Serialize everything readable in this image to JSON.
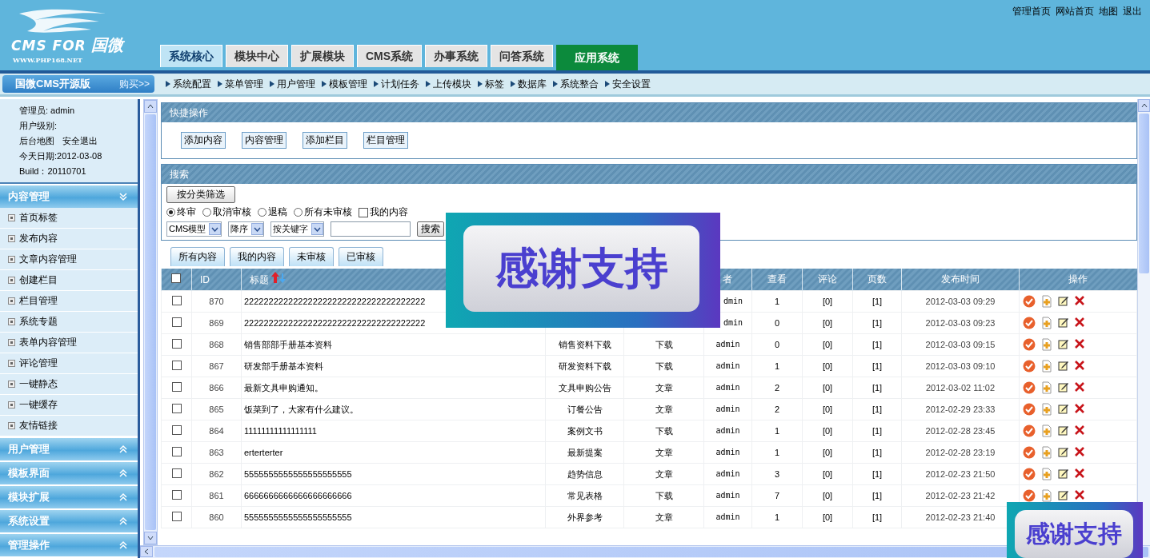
{
  "header": {
    "logo": {
      "text": "CMS FOR",
      "cn": "国微",
      "url": "WWW.PHP168.NET"
    },
    "top_links": [
      "管理首页",
      "网站首页",
      "地图",
      "退出"
    ],
    "tabs": [
      {
        "label": "系统核心",
        "selected": true,
        "kind": "normal"
      },
      {
        "label": "模块中心",
        "selected": false,
        "kind": "normal"
      },
      {
        "label": "扩展模块",
        "selected": false,
        "kind": "normal"
      },
      {
        "label": "CMS系统",
        "selected": false,
        "kind": "normal"
      },
      {
        "label": "办事系统",
        "selected": false,
        "kind": "normal"
      },
      {
        "label": "问答系统",
        "selected": false,
        "kind": "normal"
      },
      {
        "label": "应用系统",
        "selected": false,
        "kind": "app"
      }
    ]
  },
  "subnav": {
    "brand": "国微CMS开源版",
    "buy": "购买>>",
    "links": [
      "系统配置",
      "菜单管理",
      "用户管理",
      "模板管理",
      "计划任务",
      "上传模块",
      "标签",
      "数据库",
      "系统整合",
      "安全设置"
    ]
  },
  "sidebar": {
    "info": [
      "管理员: admin",
      "用户级别:",
      "今天日期:2012-03-08",
      "Build：20110701"
    ],
    "info_links": [
      "后台地图",
      "安全退出"
    ],
    "sections": [
      {
        "title": "内容管理",
        "expanded": true,
        "items": [
          "首页标签",
          "发布内容",
          "文章内容管理",
          "创建栏目",
          "栏目管理",
          "系统专题",
          "表单内容管理",
          "评论管理",
          "一键静态",
          "一键缓存",
          "友情链接"
        ]
      },
      {
        "title": "用户管理",
        "expanded": false
      },
      {
        "title": "模板界面",
        "expanded": false
      },
      {
        "title": "模块扩展",
        "expanded": false
      },
      {
        "title": "系统设置",
        "expanded": false
      },
      {
        "title": "管理操作",
        "expanded": false
      }
    ]
  },
  "quick": {
    "title": "快捷操作",
    "buttons": [
      "添加内容",
      "内容管理",
      "添加栏目",
      "栏目管理"
    ]
  },
  "search": {
    "title": "搜索",
    "filter_button": "按分类筛选",
    "radios": [
      {
        "label": "终审",
        "selected": true
      },
      {
        "label": "取消审核",
        "selected": false
      },
      {
        "label": "退稿",
        "selected": false
      },
      {
        "label": "所有未审核",
        "selected": false
      }
    ],
    "checkbox": {
      "label": "我的内容",
      "checked": false
    },
    "selects": [
      "CMS模型",
      "降序",
      "按关键字"
    ],
    "button": "搜索"
  },
  "content_tabs": [
    "所有内容",
    "我的内容",
    "未审核",
    "已审核"
  ],
  "table": {
    "header_checkbox": {
      "checked": false
    },
    "columns": [
      "ID",
      "标题",
      null,
      null,
      "者",
      "查看",
      "评论",
      "页数",
      "发布时间",
      "操作"
    ],
    "rows": [
      {
        "checked": false,
        "id": "870",
        "title": "2222222222222222222222222222222222222",
        "author": "dmin",
        "views": "1",
        "comments": "[0]",
        "pages": "[1]",
        "time": "2012-03-03 09:29"
      },
      {
        "checked": false,
        "id": "869",
        "title": "2222222222222222222222222222222222222",
        "author": "dmin",
        "views": "0",
        "comments": "[0]",
        "pages": "[1]",
        "time": "2012-03-03 09:23"
      },
      {
        "checked": false,
        "id": "868",
        "title": "销售部部手册基本资料",
        "category": "销售资料下载",
        "type": "下载",
        "author": "admin",
        "views": "0",
        "comments": "[0]",
        "pages": "[1]",
        "time": "2012-03-03 09:15"
      },
      {
        "checked": false,
        "id": "867",
        "title": "研发部手册基本资料",
        "category": "研发资料下载",
        "type": "下载",
        "author": "admin",
        "views": "1",
        "comments": "[0]",
        "pages": "[1]",
        "time": "2012-03-03 09:10"
      },
      {
        "checked": false,
        "id": "866",
        "title": "最新文具申购通知。",
        "category": "文具申购公告",
        "type": "文章",
        "author": "admin",
        "views": "2",
        "comments": "[0]",
        "pages": "[1]",
        "time": "2012-03-02 11:02"
      },
      {
        "checked": false,
        "id": "865",
        "title": "饭菜到了，大家有什么建议。",
        "category": "订餐公告",
        "type": "文章",
        "author": "admin",
        "views": "2",
        "comments": "[0]",
        "pages": "[1]",
        "time": "2012-02-29 23:33"
      },
      {
        "checked": false,
        "id": "864",
        "title": "11111111111111111",
        "category": "案例文书",
        "type": "下载",
        "author": "admin",
        "views": "1",
        "comments": "[0]",
        "pages": "[1]",
        "time": "2012-02-28 23:45"
      },
      {
        "checked": false,
        "id": "863",
        "title": "erterterter",
        "category": "最新提案",
        "type": "文章",
        "author": "admin",
        "views": "1",
        "comments": "[0]",
        "pages": "[1]",
        "time": "2012-02-28 23:19"
      },
      {
        "checked": false,
        "id": "862",
        "title": "5555555555555555555555",
        "category": "趋势信息",
        "type": "文章",
        "author": "admin",
        "views": "3",
        "comments": "[0]",
        "pages": "[1]",
        "time": "2012-02-23 21:50"
      },
      {
        "checked": false,
        "id": "861",
        "title": "6666666666666666666666",
        "category": "常见表格",
        "type": "下载",
        "author": "admin",
        "views": "7",
        "comments": "[0]",
        "pages": "[1]",
        "time": "2012-02-23 21:42"
      },
      {
        "checked": false,
        "id": "860",
        "title": "5555555555555555555555",
        "category": "外界参考",
        "type": "文章",
        "author": "admin",
        "views": "1",
        "comments": "[0]",
        "pages": "[1]",
        "time": "2012-02-23 21:40"
      }
    ]
  },
  "banners": [
    {
      "text": "感谢支持"
    },
    {
      "text": "感谢支持"
    }
  ]
}
